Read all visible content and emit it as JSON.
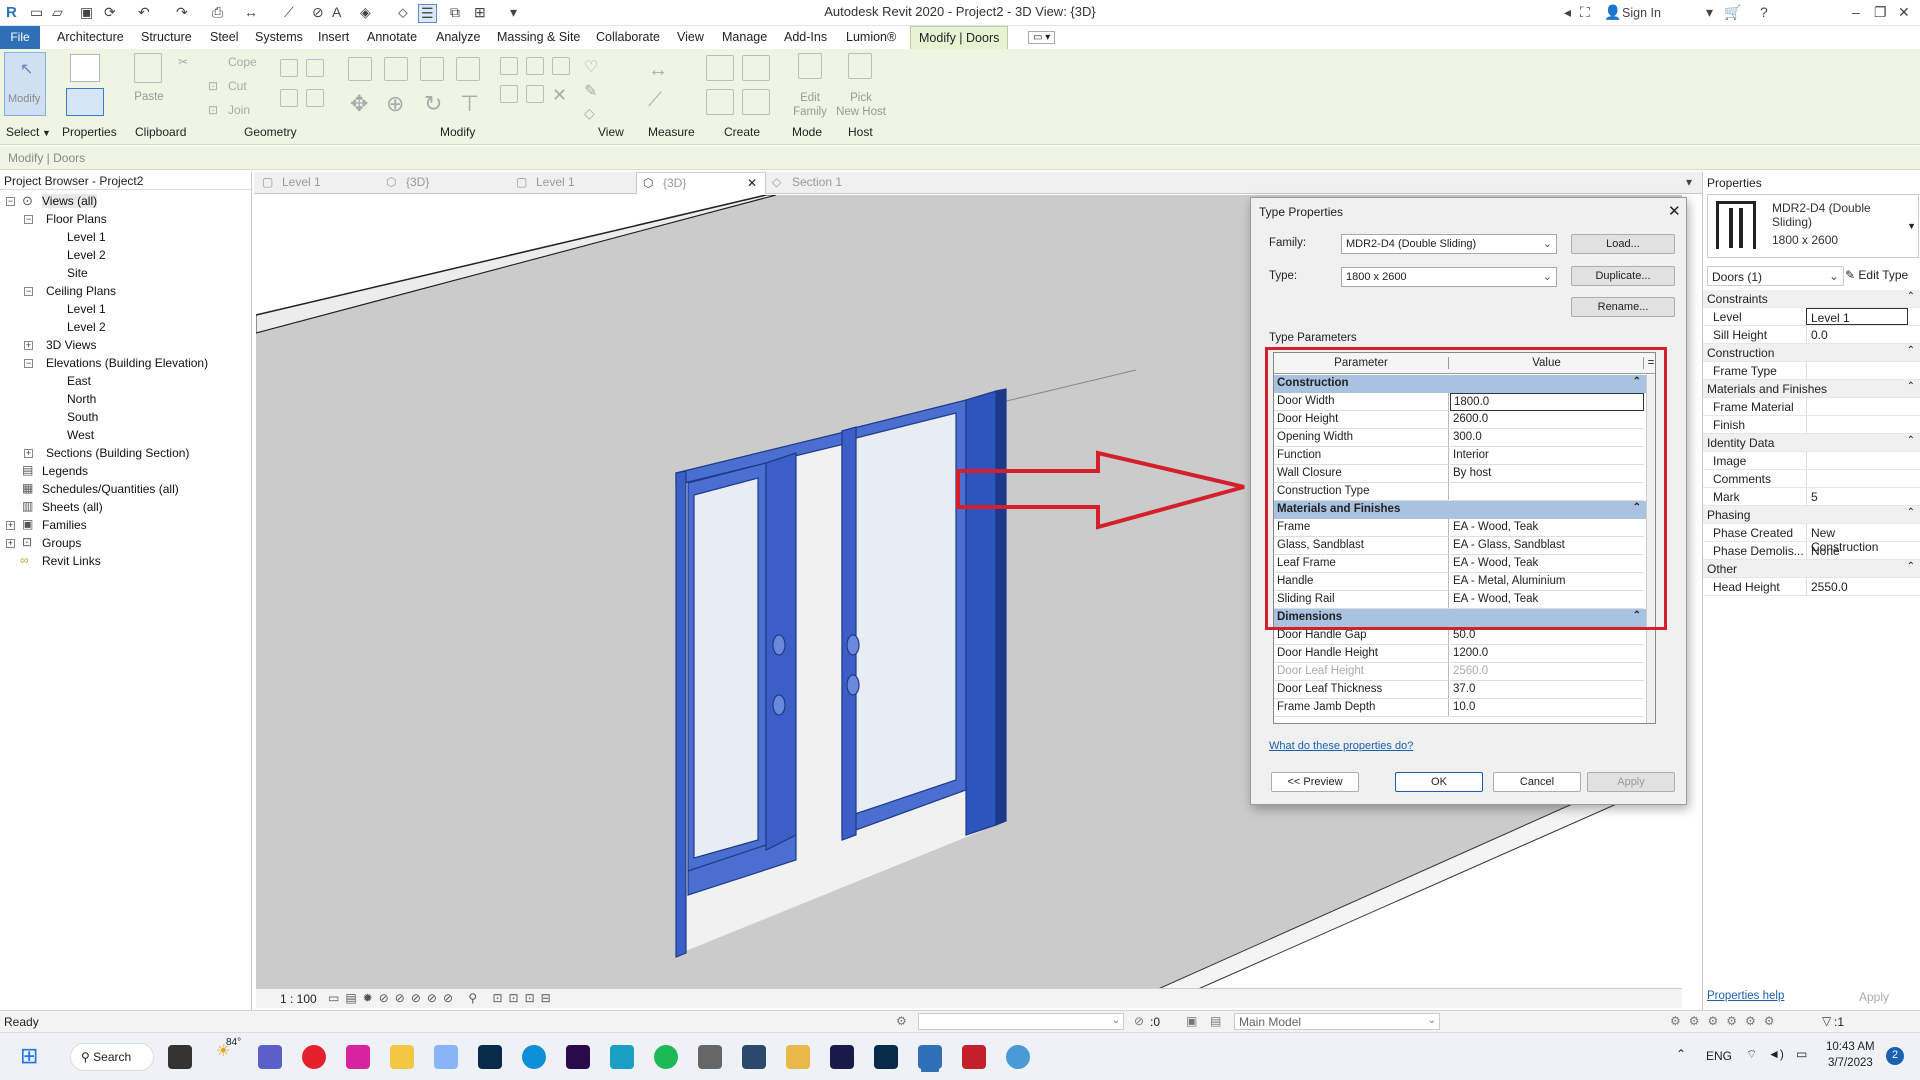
{
  "title": "Autodesk Revit 2020 - Project2 - 3D View: {3D}",
  "account": {
    "sign_in": "Sign In"
  },
  "menu": [
    "File",
    "Architecture",
    "Structure",
    "Steel",
    "Systems",
    "Insert",
    "Annotate",
    "Analyze",
    "Massing & Site",
    "Collaborate",
    "View",
    "Manage",
    "Add-Ins",
    "Lumion®",
    "Modify | Doors"
  ],
  "ribbon": {
    "panels": [
      "Select",
      "Properties",
      "Clipboard",
      "Geometry",
      "Modify",
      "View",
      "Measure",
      "Create",
      "Mode",
      "Host"
    ],
    "buttons": {
      "modify": "Modify",
      "paste": "Paste",
      "cope": "Cope",
      "cut": "Cut",
      "join": "Join",
      "edit_family": "Edit\nFamily",
      "pick_new_host": "Pick\nNew Host"
    }
  },
  "context_label": "Modify | Doors",
  "browser": {
    "title": "Project Browser - Project2",
    "items": [
      "Views (all)",
      "Floor Plans",
      "Level 1",
      "Level 2",
      "Site",
      "Ceiling Plans",
      "Level 1",
      "Level 2",
      "3D Views",
      "Elevations (Building Elevation)",
      "East",
      "North",
      "South",
      "West",
      "Sections (Building Section)",
      "Legends",
      "Schedules/Quantities (all)",
      "Sheets (all)",
      "Families",
      "Groups",
      "Revit Links"
    ]
  },
  "view_tabs": [
    "Level 1",
    "{3D}",
    "Level 1",
    "{3D}",
    "Section 1"
  ],
  "view_control": {
    "scale": "1 : 100"
  },
  "properties": {
    "title": "Properties",
    "family_name": "MDR2-D4 (Double Sliding)",
    "type_name": "1800 x 2600",
    "selector": "Doors (1)",
    "edit_type": "Edit Type",
    "rows": [
      {
        "section": "Constraints"
      },
      {
        "name": "Level",
        "value": "Level 1"
      },
      {
        "name": "Sill Height",
        "value": "0.0"
      },
      {
        "section": "Construction"
      },
      {
        "name": "Frame Type",
        "value": ""
      },
      {
        "section": "Materials and Finishes"
      },
      {
        "name": "Frame Material",
        "value": ""
      },
      {
        "name": "Finish",
        "value": ""
      },
      {
        "section": "Identity Data"
      },
      {
        "name": "Image",
        "value": ""
      },
      {
        "name": "Comments",
        "value": ""
      },
      {
        "name": "Mark",
        "value": "5"
      },
      {
        "section": "Phasing"
      },
      {
        "name": "Phase Created",
        "value": "New Construction"
      },
      {
        "name": "Phase Demolis...",
        "value": "None"
      },
      {
        "section": "Other"
      },
      {
        "name": "Head Height",
        "value": "2550.0"
      }
    ],
    "help_link": "Properties help",
    "apply": "Apply"
  },
  "dialog": {
    "title": "Type Properties",
    "family_label": "Family:",
    "family_value": "MDR2-D4 (Double Sliding)",
    "type_label": "Type:",
    "type_value": "1800 x 2600",
    "load": "Load...",
    "duplicate": "Duplicate...",
    "rename": "Rename...",
    "type_params_label": "Type Parameters",
    "col_param": "Parameter",
    "col_value": "Value",
    "col_eq": "=",
    "rows": [
      {
        "section": "Construction"
      },
      {
        "name": "Door Width",
        "value": "1800.0"
      },
      {
        "name": "Door Height",
        "value": "2600.0"
      },
      {
        "name": "Opening Width",
        "value": "300.0"
      },
      {
        "name": "Function",
        "value": "Interior"
      },
      {
        "name": "Wall Closure",
        "value": "By host"
      },
      {
        "name": "Construction Type",
        "value": ""
      },
      {
        "section": "Materials and Finishes"
      },
      {
        "name": "Frame",
        "value": "EA - Wood, Teak"
      },
      {
        "name": "Glass, Sandblast",
        "value": "EA - Glass, Sandblast"
      },
      {
        "name": "Leaf Frame",
        "value": "EA - Wood, Teak"
      },
      {
        "name": "Handle",
        "value": "EA - Metal, Aluminium"
      },
      {
        "name": "Sliding Rail",
        "value": "EA - Wood, Teak"
      },
      {
        "section": "Dimensions"
      },
      {
        "name": "Door Handle Gap",
        "value": "50.0"
      },
      {
        "name": "Door Handle Height",
        "value": "1200.0"
      },
      {
        "name": "Door Leaf Height",
        "value": "2560.0",
        "greyed": true
      },
      {
        "name": "Door Leaf Thickness",
        "value": "37.0"
      },
      {
        "name": "Frame Jamb Depth",
        "value": "10.0"
      }
    ],
    "help_link": "What do these properties do?",
    "preview": "<< Preview",
    "ok": "OK",
    "cancel": "Cancel",
    "apply": "Apply"
  },
  "status": {
    "text": "Ready",
    "model": "Main Model",
    "count": ":0",
    "filter": ":1"
  },
  "taskbar": {
    "search": "Search",
    "weather": "84°",
    "lang": "ENG",
    "time": "10:43 AM",
    "date": "3/7/2023",
    "badge": "2"
  },
  "colors": {
    "selection_blue": "#2a52be",
    "annotation_red": "#d4202c",
    "ribbon_green": "#eef5e3"
  }
}
